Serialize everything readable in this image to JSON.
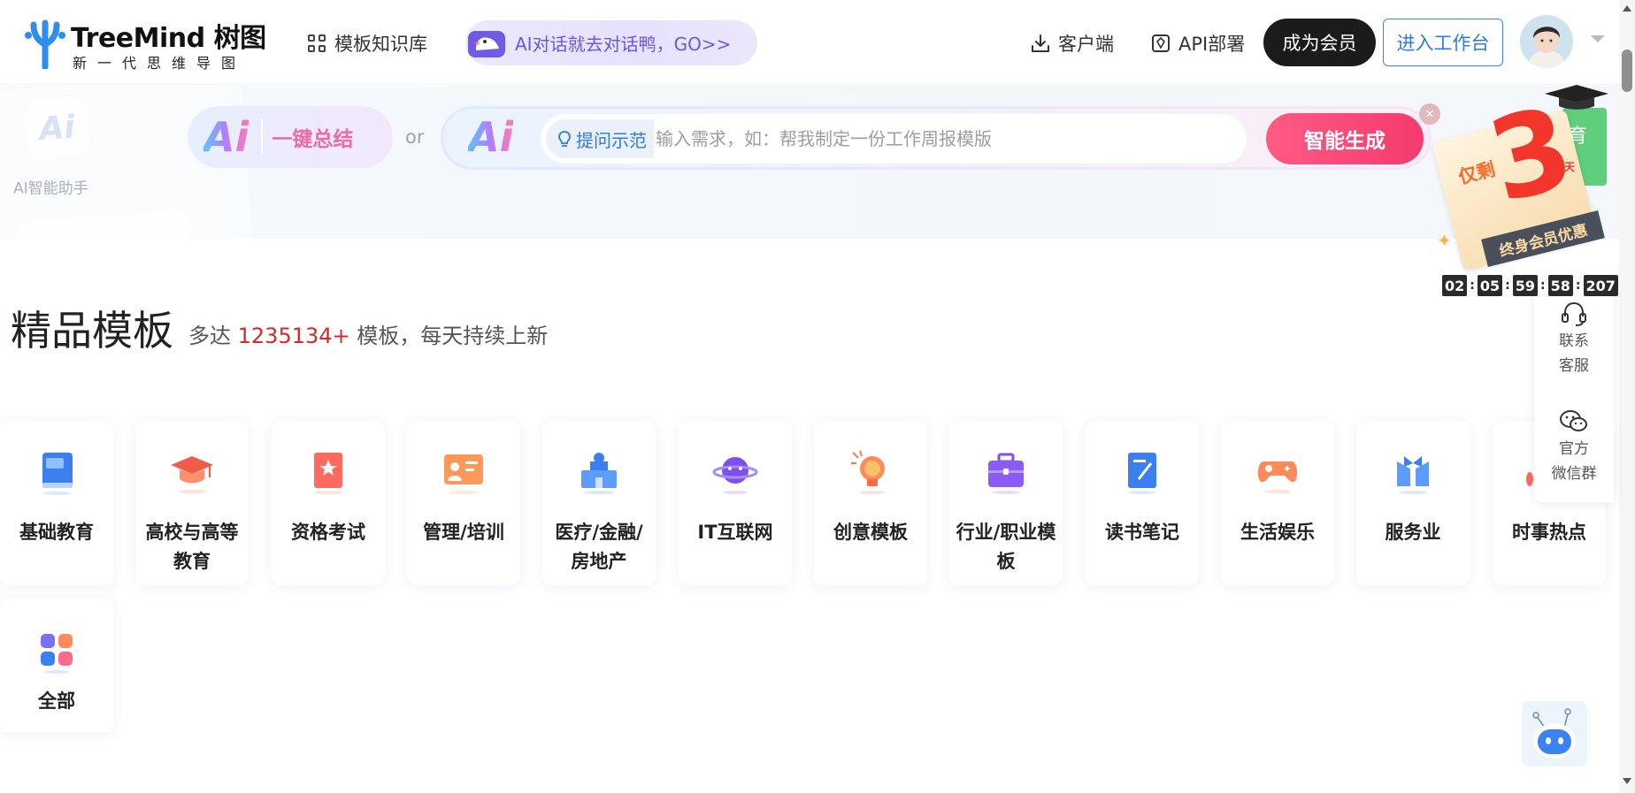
{
  "header": {
    "logo_name": "TreeMind 树图",
    "logo_tagline": "新一代思维导图",
    "nav_templates": "模板知识库",
    "ai_promo": "AI对话就去对话鸭，GO>>",
    "client": "客户端",
    "api": "API部署",
    "member_btn": "成为会员",
    "workbench_btn": "进入工作台"
  },
  "assistant": {
    "ai_glyph": "Ai",
    "label": "AI智能助手"
  },
  "ai_bar": {
    "summary_ai": "Ai",
    "summary_label": "一键总结",
    "or_text": "or",
    "gen_ai": "Ai",
    "hint_label": "提问示范",
    "input_placeholder": "输入需求，如：帮我制定一份工作周报模版",
    "input_value": "",
    "generate_btn": "智能生成",
    "close_glyph": "×"
  },
  "promo": {
    "only_left": "仅剩",
    "days_number": "3",
    "days_unit": "天",
    "ribbon": "终身会员优惠",
    "side_tag": "育",
    "countdown": [
      "02",
      "05",
      "59",
      "58",
      "207"
    ]
  },
  "side_tools": {
    "service": [
      "联系",
      "客服"
    ],
    "wechat": [
      "官方",
      "微信群"
    ]
  },
  "section": {
    "title": "精品模板",
    "sub_prefix": "多达 ",
    "sub_count": "1235134+",
    "sub_suffix": " 模板，每天持续上新"
  },
  "categories": [
    {
      "label": "基础教育",
      "icon": "book-icon"
    },
    {
      "label": "高校与高等教育",
      "icon": "graduation-cap-icon"
    },
    {
      "label": "资格考试",
      "icon": "certificate-icon"
    },
    {
      "label": "管理/培训",
      "icon": "presentation-icon"
    },
    {
      "label": "医疗/金融/房地产",
      "icon": "building-icon"
    },
    {
      "label": "IT互联网",
      "icon": "planet-icon"
    },
    {
      "label": "创意模板",
      "icon": "lightbulb-icon"
    },
    {
      "label": "行业/职业模板",
      "icon": "briefcase-icon"
    },
    {
      "label": "读书笔记",
      "icon": "notebook-icon"
    },
    {
      "label": "生活娱乐",
      "icon": "gamepad-icon"
    },
    {
      "label": "服务业",
      "icon": "bowtie-icon"
    },
    {
      "label": "时事热点",
      "icon": "hot-topic-icon"
    },
    {
      "label": "全部",
      "icon": "all-apps-icon"
    }
  ],
  "colors": {
    "accent_blue": "#2f7ae0",
    "generate_pink": "#f43b6d",
    "count_red": "#d42a2a",
    "ai_promo_purple": "#6b57e0"
  }
}
